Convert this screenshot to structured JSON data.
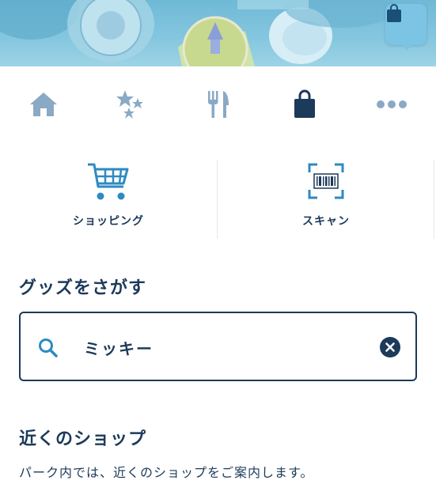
{
  "hero": {
    "bag_icon": "shopping-bag-icon"
  },
  "nav": {
    "items": [
      {
        "icon": "home-icon",
        "active": false
      },
      {
        "icon": "stars-icon",
        "active": false
      },
      {
        "icon": "fork-knife-icon",
        "active": false
      },
      {
        "icon": "shopping-bag-icon",
        "active": true
      },
      {
        "icon": "more-icon",
        "active": false
      }
    ],
    "colors": {
      "inactive": "#8aa9c4",
      "active": "#1c3a5a"
    }
  },
  "actions": {
    "shopping_label": "ショッピング",
    "scan_label": "スキャン",
    "accent": "#2e8ac2"
  },
  "search_section": {
    "title": "グッズをさがす",
    "value": "ミッキー"
  },
  "nearby": {
    "title": "近くのショップ",
    "description": "パーク内では、近くのショップをご案内します。"
  }
}
